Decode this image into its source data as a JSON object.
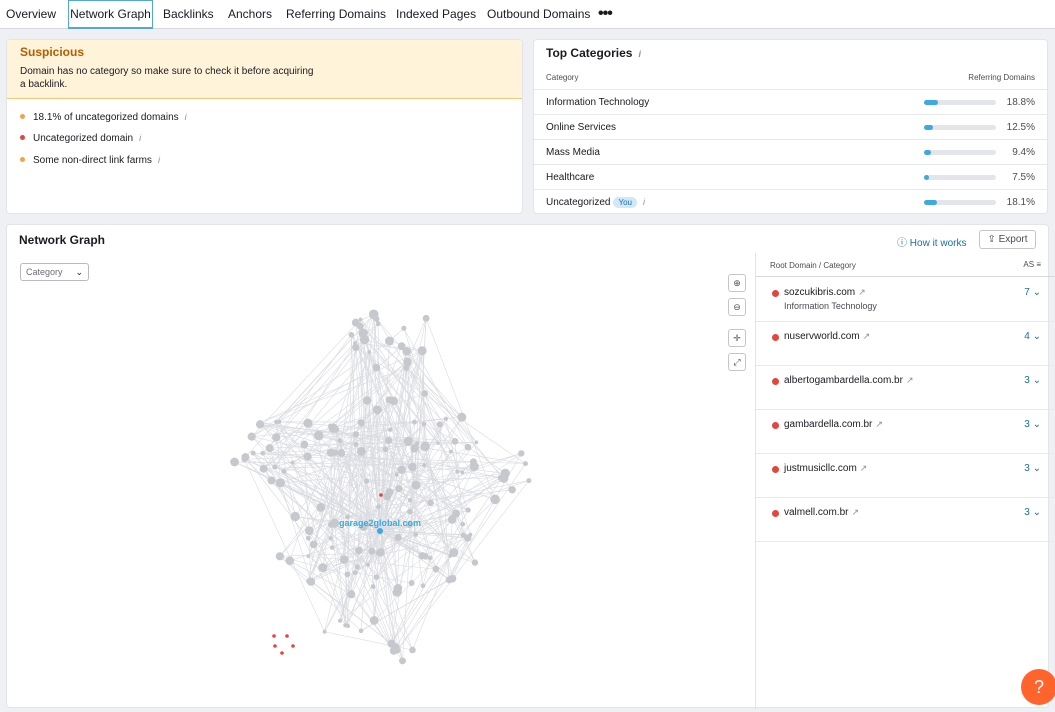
{
  "tabs": [
    "Overview",
    "Network Graph",
    "Backlinks",
    "Anchors",
    "Referring Domains",
    "Indexed Pages",
    "Outbound Domains"
  ],
  "more_icon": "•••",
  "suspicious": {
    "title": "Suspicious",
    "description": "Domain has no category so make sure to check it before acquiring a backlink.",
    "items": [
      {
        "text": "18.1% of uncategorized domains",
        "color": "#f3a24c"
      },
      {
        "text": "Uncategorized domain",
        "color": "#e4453e"
      },
      {
        "text": "Some non-direct link farms",
        "color": "#f3a24c"
      }
    ]
  },
  "top_categories": {
    "title": "Top Categories",
    "col_category": "Category",
    "col_referring": "Referring Domains",
    "you_badge": "You",
    "rows": [
      {
        "name": "Information Technology",
        "pct_text": "18.8%",
        "fill": 0.188
      },
      {
        "name": "Online Services",
        "pct_text": "12.5%",
        "fill": 0.125
      },
      {
        "name": "Mass Media",
        "pct_text": "9.4%",
        "fill": 0.094
      },
      {
        "name": "Healthcare",
        "pct_text": "7.5%",
        "fill": 0.075
      },
      {
        "name": "Uncategorized",
        "pct_text": "18.1%",
        "fill": 0.181
      }
    ]
  },
  "network": {
    "title": "Network Graph",
    "how_it_works": "How it works",
    "export": "Export",
    "category_select": "Category",
    "center_label": "garage2global.com",
    "panel_col_domain": "Root Domain / Category",
    "panel_col_as": "AS",
    "domains": [
      {
        "name": "sozcukibris.com",
        "category": "Information Technology",
        "as": "7"
      },
      {
        "name": "nuservworld.com",
        "category": "",
        "as": "4"
      },
      {
        "name": "albertogambardella.com.br",
        "category": "",
        "as": "3"
      },
      {
        "name": "gambardella.com.br",
        "category": "",
        "as": "3"
      },
      {
        "name": "justmusicllc.com",
        "category": "",
        "as": "3"
      },
      {
        "name": "valmell.com.br",
        "category": "",
        "as": "3"
      }
    ]
  },
  "help": "?",
  "colors": {
    "accent": "#1a6fa5",
    "bar": "#3ea8e0",
    "danger": "#e4453e",
    "warning": "#f3a24c",
    "help": "#ff642d"
  }
}
